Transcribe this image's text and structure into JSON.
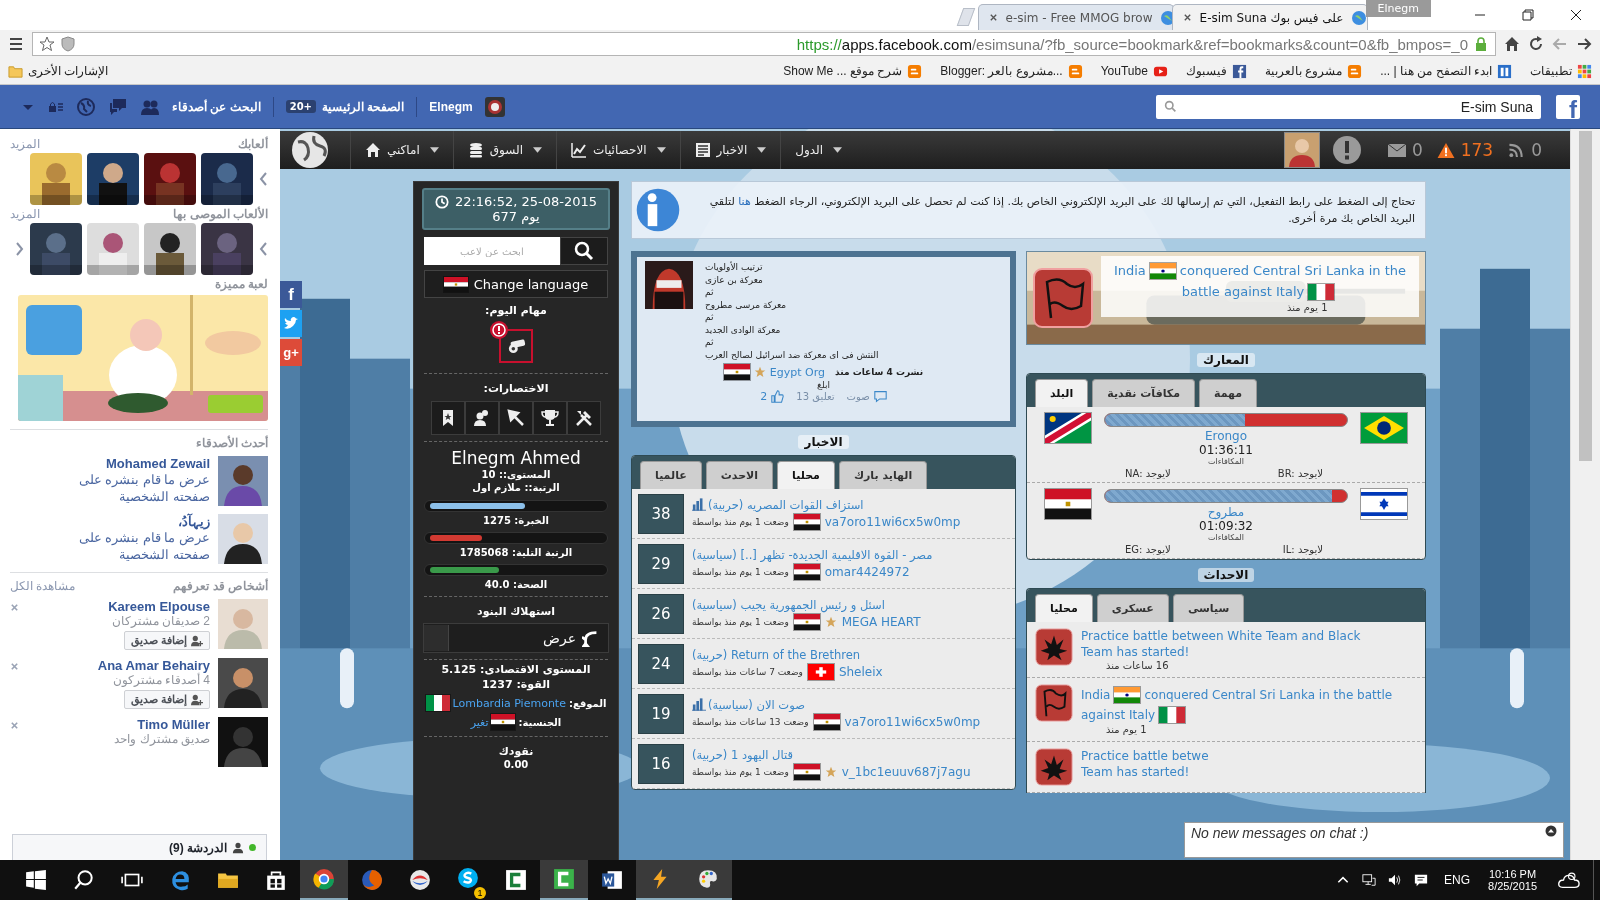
{
  "browser": {
    "tabs": [
      {
        "label": "E-sim Suna على فيس بوك",
        "selected": true
      },
      {
        "label": "e-sim - Free MMOG brow",
        "selected": false
      }
    ],
    "profile": "Elnegm",
    "url": {
      "scheme": "https://",
      "host": "apps.facebook.com",
      "path": "/esimsuna/?fb_source=bookmark&ref=bookmarks&count=0&fb_bmpos=_0"
    },
    "bookmarks": [
      {
        "kind": "apps",
        "label": "تطبيقات"
      },
      {
        "kind": "site",
        "label": "ابدء التصفح من هنا | ..."
      },
      {
        "kind": "blogger",
        "label": "مشروع بالعربية"
      },
      {
        "kind": "facebook",
        "label": "فيسبوك"
      },
      {
        "kind": "youtube",
        "label": "YouTube"
      },
      {
        "kind": "blogger",
        "label": "Blogger: مشروع بالعر..."
      },
      {
        "kind": "blogger",
        "label": "Show Me ... شرح موقع"
      }
    ],
    "other_bookmarks": "الإشارات الأخرى"
  },
  "facebook_bar": {
    "logo": "f",
    "search": {
      "value": "E-sim Suna"
    },
    "profile": "Elnegm",
    "home": "الصفحة الرئيسية",
    "home_badge": "20+",
    "find_friends": "البحث عن أصدقاء"
  },
  "sidebar": {
    "your_games": {
      "title": "ألعابك",
      "more": "المزيد"
    },
    "recommended": {
      "title": "الألعاب الموصى بها",
      "more": "المزيد"
    },
    "featured": {
      "title": "لعبة مميزة"
    },
    "recent_friends": {
      "title": "أحدث الأصدقاء",
      "items": [
        {
          "name": "Mohamed Zewail",
          "text": "عرض ما قام بنشره على صفحته الشخصية"
        },
        {
          "name": "زيہآدُ،",
          "text": "عرض ما قام بنشره على صفحته الشخصية"
        }
      ]
    },
    "people": {
      "title": "أشخاص قد تعرفهم",
      "see_all": "مشاهدة الكل",
      "items": [
        {
          "name": "Kareem Elpouse",
          "mutual": "2 صديقان مشتركان",
          "button": "إضافة صديق"
        },
        {
          "name": "Ana Amar Behairy",
          "mutual": "4 أصدقاء مشتركون",
          "button": "إضافة صديق"
        },
        {
          "name": "Timo Müller",
          "mutual": "صديق مشترك واحد"
        }
      ]
    },
    "chat": {
      "label": "الدردشة (9)",
      "online": true
    }
  },
  "social": [
    {
      "kind": "facebook",
      "label": "f"
    },
    {
      "kind": "twitter"
    },
    {
      "kind": "google",
      "label": "g+"
    }
  ],
  "game": {
    "nav": {
      "menus": [
        {
          "label": "الدول"
        },
        {
          "label": "الاخبار"
        },
        {
          "label": "الاحصائيات"
        },
        {
          "label": "السوق"
        },
        {
          "label": "اماكني"
        }
      ],
      "messages": "0",
      "alerts": "173",
      "feeds": "0"
    },
    "player": {
      "clock": "22:16:52, 25-08-2015",
      "day": "يوم 677",
      "search": {
        "placeholder": "ابحث عن لاعب"
      },
      "language": "Change language",
      "language_flag": {
        "kind": "eg"
      },
      "tasks_title": "مهام اليوم:",
      "shortcuts_title": "الاختصارات:",
      "name": "Elnegm Ahmed",
      "level": "المستوى:: 10",
      "rank": "الرتبة:: ملازم اول",
      "bars": [
        {
          "label": "الخبرة:",
          "value": "1275",
          "level": 0.55,
          "color": "#8cc0ea"
        },
        {
          "label": "الرتبة التلية:",
          "value": "1785068",
          "level": 0.3,
          "color": "#d23a32"
        },
        {
          "label": "الصحة:",
          "value": "40.0",
          "level": 0.4,
          "color": "#3a9a4a"
        }
      ],
      "consume_title": "استهلاك البنود",
      "show_button": "عرض",
      "economy": "المستوى الاقتصادى: 5.125",
      "strength": "القوة: 1237",
      "location_label": "الموقع:",
      "location": "Lombardia Piemonte",
      "location_flag": {
        "kind": "it"
      },
      "citizenship_label": "الجنسية:",
      "citizenship_flag": {
        "kind": "eg"
      },
      "change": "تغير",
      "money_title": "نقودك",
      "money": "0.00"
    },
    "notice": {
      "before": "تحتاج إلى الضغط على رابط التفعيل، التي تم إرسالها لك على البريد الإلكتروني الخاص بك. إذا كنت لم تحصل على البريد الإلكتروني، الرجاء الضغط",
      "link": "هنا",
      "after": "لتلقي البريد الخاص بك مرة أخرى."
    },
    "article": {
      "lines": [
        "ترتيب الأولويات",
        "معركة بن عازى",
        "ثم",
        "معركة مرسى مطروح",
        "ثم",
        "معركة الوادى الجديد",
        "ثم",
        "النتش فى اى معركة ضد اسرائيل لصالح العرب"
      ],
      "posted": "نشرت 4 ساعات منذ",
      "author": "Egypt Org",
      "star": true,
      "flag": {
        "kind": "eg"
      },
      "report": "ابلغ",
      "vote": "صوت",
      "comments": "تعليق 13",
      "likes": "2"
    },
    "news": {
      "title": "الاخبار",
      "tabs": [
        {
          "label": "الهايد بارك",
          "selected": false
        },
        {
          "label": "محليا",
          "selected": true
        },
        {
          "label": "الاحدث",
          "selected": false
        },
        {
          "label": "عالميا",
          "selected": false
        }
      ],
      "items": [
        {
          "votes": "38",
          "title": "استزاف القوات المصريه (حربية)",
          "ranked": true,
          "posted": "وضعت 1 يوم منذ بواسطة",
          "flag": {
            "kind": "eg"
          },
          "star": false,
          "author": "va7oro11wi6cx5w0mp"
        },
        {
          "votes": "29",
          "title": "مصر - القوة الاقليمية الجديدة- تظهر [..] (سياسية)",
          "ranked": false,
          "posted": "وضعت 1 يوم منذ بواسطة",
          "flag": {
            "kind": "eg"
          },
          "star": false,
          "author": "omar4424972"
        },
        {
          "votes": "26",
          "title": "اسئل و رئيس الجمهورية يجيب (سياسية)",
          "ranked": false,
          "posted": "وضعت 1 يوم منذ بواسطة",
          "flag": {
            "kind": "eg"
          },
          "star": true,
          "author": "MEGA HEART"
        },
        {
          "votes": "24",
          "title": "Return of the Brethren (حربية)",
          "ranked": false,
          "posted": "وضعت 7 ساعات منذ بواسطة",
          "flag": {
            "kind": "ch"
          },
          "star": false,
          "author": "Sheleix"
        },
        {
          "votes": "19",
          "title": "صوت الان (سياسية)",
          "ranked": true,
          "posted": "وضعت 13 ساعات منذ بواسطة",
          "flag": {
            "kind": "eg"
          },
          "star": false,
          "author": "va7oro11wi6cx5w0mp"
        },
        {
          "votes": "16",
          "title": "قتال اليهود 1 (حربية)",
          "ranked": false,
          "posted": "وضعت 1 يوم منذ بواسطة",
          "flag": {
            "kind": "eg"
          },
          "star": true,
          "author": "v_1bc1euuv687j7agu"
        }
      ]
    },
    "conquest": {
      "country": "India",
      "flag": {
        "kind": "in"
      },
      "text": "conquered Central Sri Lanka in the battle against Italy",
      "enemy_flag": {
        "kind": "it"
      },
      "time": "1 يوم منذ"
    },
    "battles": {
      "title": "المعارك",
      "tabs": [
        {
          "label": "مهمة",
          "selected": false
        },
        {
          "label": "مكافآت نقدية",
          "selected": false
        },
        {
          "label": "البلد",
          "selected": true
        }
      ],
      "items": [
        {
          "left_flag": {
            "kind": "na"
          },
          "right_flag": {
            "kind": "br"
          },
          "level": 0.58,
          "region": "Erongo",
          "timer": "01:36:11",
          "rewards": "المكافاءات",
          "left_note": "NA: لايوجد",
          "right_note": "BR: لايوجد"
        },
        {
          "left_flag": {
            "kind": "eg"
          },
          "right_flag": {
            "kind": "il"
          },
          "level": 0.94,
          "region": "مطروح",
          "timer": "01:09:32",
          "rewards": "المكافاءات",
          "left_note": "EG: لايوجد",
          "right_note": "IL: لايوجد"
        }
      ]
    },
    "events": {
      "title": "الاحداث",
      "tabs": [
        {
          "label": "سياسى",
          "selected": false
        },
        {
          "label": "عسكرى",
          "selected": false
        },
        {
          "label": "محليا",
          "selected": true
        }
      ],
      "items": [
        {
          "kind": "battle",
          "lines": [
            "Practice battle between White Team and Black",
            "Team has started!"
          ],
          "time": "16 ساعات منذ"
        },
        {
          "kind": "conquest",
          "country": "India",
          "flag": {
            "kind": "in"
          },
          "text": "conquered Central Sri Lanka in the battle against Italy",
          "enemy_flag": {
            "kind": "it"
          },
          "time": "1 يوم منذ"
        },
        {
          "kind": "battle",
          "lines": [
            "Practice battle betwe",
            "Team has started!"
          ]
        }
      ]
    },
    "chat_box": {
      "text": "No new messages on chat :)"
    }
  },
  "taskbar": {
    "skype_badge": "1",
    "language": "ENG",
    "time": "10:16 PM",
    "date": "8/25/2015"
  }
}
